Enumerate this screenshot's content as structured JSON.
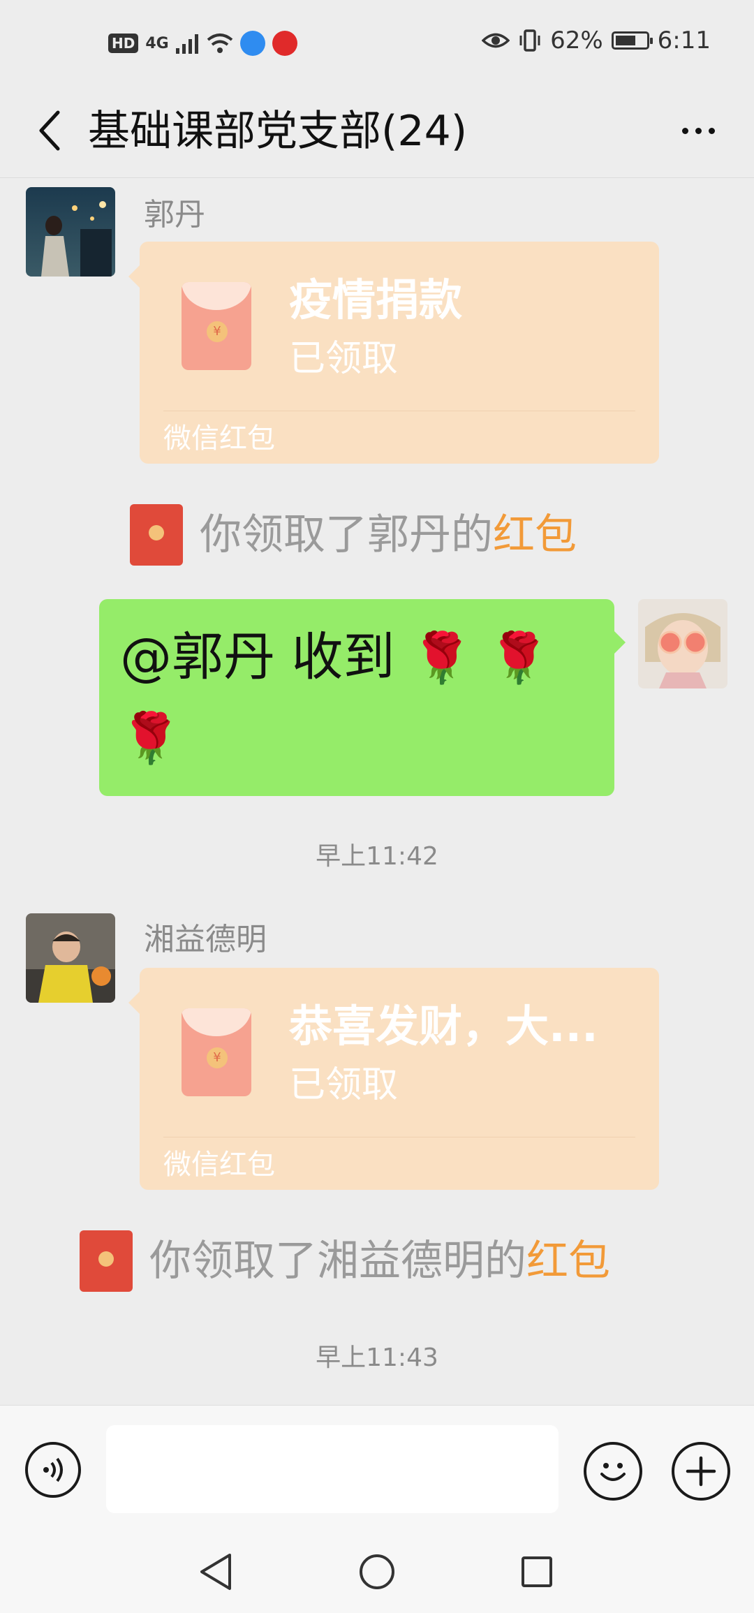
{
  "status_bar": {
    "hd_label": "HD",
    "network_label": "4G",
    "battery_percent": "62%",
    "time": "6:11"
  },
  "header": {
    "title": "基础课部党支部(24)"
  },
  "messages": [
    {
      "type": "red_packet",
      "sender": "郭丹",
      "title": "疫情捐款",
      "status": "已领取",
      "label": "微信红包"
    },
    {
      "type": "system",
      "prefix": "你领取了郭丹的",
      "highlight": "红包"
    },
    {
      "type": "text_self",
      "text": "@郭丹  收到",
      "emoji": "🌹"
    },
    {
      "type": "timestamp",
      "text": "早上11:42"
    },
    {
      "type": "red_packet",
      "sender": "湘益德明",
      "title": "恭喜发财，大...",
      "status": "已领取",
      "label": "微信红包"
    },
    {
      "type": "system",
      "prefix": "你领取了湘益德明的",
      "highlight": "红包"
    },
    {
      "type": "timestamp",
      "text": "早上11:43"
    }
  ],
  "input_bar": {
    "value": "",
    "voice_icon": "voice-icon",
    "emoji_icon": "emoji-icon",
    "plus_icon": "plus-icon"
  },
  "colors": {
    "background": "#ededed",
    "red_packet": "#fae0c2",
    "self_bubble": "#95ec69",
    "highlight": "#f29a38"
  }
}
